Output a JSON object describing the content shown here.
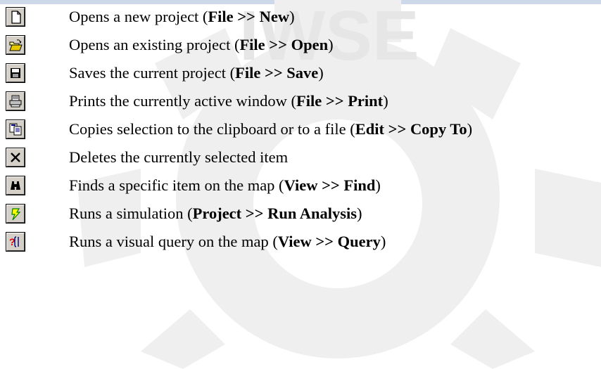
{
  "watermark": {
    "text": "IWSE",
    "color": "#e6e6e6"
  },
  "rows": [
    {
      "icon": "new-document-icon",
      "prefix": "Opens a new project (",
      "menu": "File",
      "sep": " >> ",
      "command": "New",
      "suffix": ")"
    },
    {
      "icon": "open-folder-icon",
      "prefix": "Opens an existing project (",
      "menu": "File",
      "sep": " >> ",
      "command": "Open",
      "suffix": ")"
    },
    {
      "icon": "save-disk-icon",
      "prefix": "Saves the current project (",
      "menu": "File",
      "sep": " >> ",
      "command": "Save",
      "suffix": ")"
    },
    {
      "icon": "printer-icon",
      "prefix": "Prints the currently active window (",
      "menu": "File",
      "sep": " >> ",
      "command": "Print",
      "suffix": ")"
    },
    {
      "icon": "copy-to-icon",
      "prefix": "Copies selection to the clipboard or to a file (",
      "menu": "Edit",
      "sep": " >> ",
      "command": "Copy To",
      "suffix": ")"
    },
    {
      "icon": "delete-x-icon",
      "prefix": "Deletes the currently selected item",
      "menu": "",
      "sep": "",
      "command": "",
      "suffix": ""
    },
    {
      "icon": "binoculars-icon",
      "prefix": "Finds a specific item on the map (",
      "menu": "View",
      "sep": " >> ",
      "command": "Find",
      "suffix": ")"
    },
    {
      "icon": "lightning-run-icon",
      "prefix": "Runs a simulation (",
      "menu": "Project",
      "sep": " >> ",
      "command": "Run Analysis",
      "suffix": ")"
    },
    {
      "icon": "query-icon",
      "prefix": "Runs a visual query on the map (",
      "menu": "View",
      "sep": " >> ",
      "command": "Query",
      "suffix": ")"
    }
  ]
}
